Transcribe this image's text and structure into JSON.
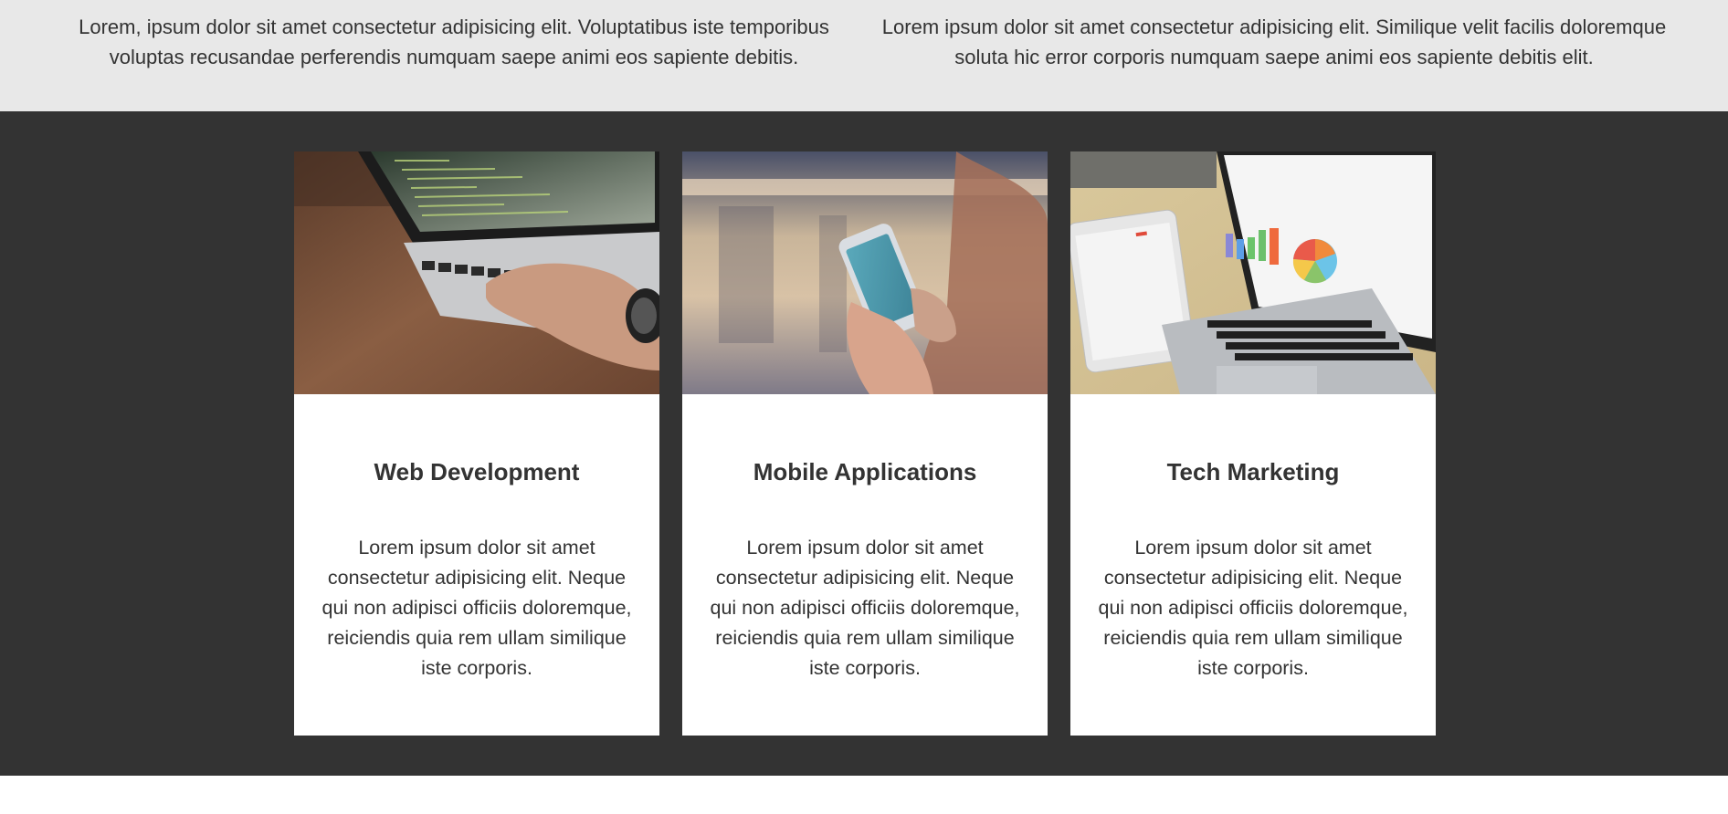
{
  "intro": {
    "left_text": "Lorem, ipsum dolor sit amet consectetur adipisicing elit. Voluptatibus iste temporibus voluptas recusandae perferendis numquam saepe animi eos sapiente debitis.",
    "right_text": "Lorem ipsum dolor sit amet consectetur adipisicing elit. Similique velit facilis doloremque soluta hic error corporis numquam saepe animi eos sapiente debitis elit."
  },
  "services": {
    "cards": [
      {
        "image": "laptop-coding-photo",
        "title": "Web Development",
        "text": "Lorem ipsum dolor sit amet consectetur adipisicing elit. Neque qui non adipisci officiis doloremque, reiciendis quia rem ullam similique iste corporis."
      },
      {
        "image": "smartphone-in-hands-photo",
        "title": "Mobile Applications",
        "text": "Lorem ipsum dolor sit amet consectetur adipisicing elit. Neque qui non adipisci officiis doloremque, reiciendis quia rem ullam similique iste corporis."
      },
      {
        "image": "laptop-tablet-charts-photo",
        "title": "Tech Marketing",
        "text": "Lorem ipsum dolor sit amet consectetur adipisicing elit. Neque qui non adipisci officiis doloremque, reiciendis quia rem ullam similique iste corporis."
      }
    ]
  },
  "colors": {
    "top_band_bg": "#e8e8e8",
    "dark_band_bg": "#333333",
    "card_bg": "#ffffff",
    "text": "#333333"
  }
}
